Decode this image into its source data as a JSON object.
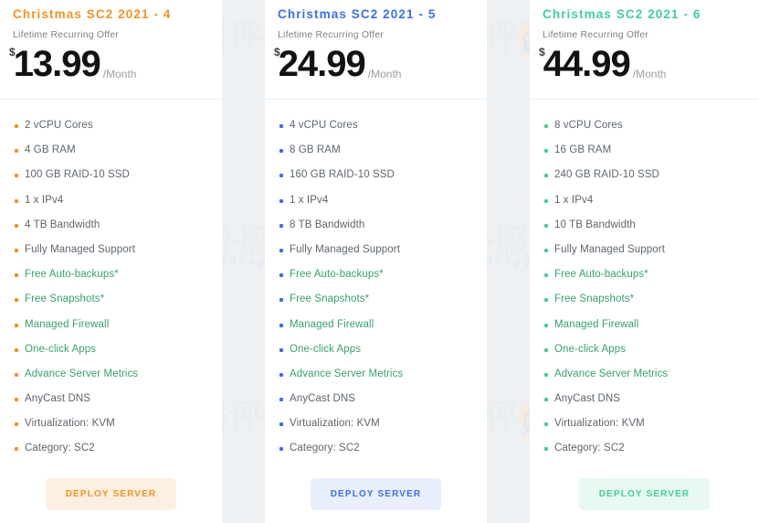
{
  "watermark": {
    "cn_text": "国外服务器评测",
    "url_text": "-www.idcspy.org-",
    "logo_icon": "globe-speech-bubble-logo"
  },
  "columns": [
    {
      "id": "sc2-2021-4",
      "title": "Christmas SC2 2021 - 4",
      "subtitle": "Lifetime Recurring Offer",
      "currency": "$",
      "amount": "13.99",
      "period": "/Month",
      "accent": "#f6921e",
      "title_color": "#f6921e",
      "bullet_color": "#f6921e",
      "button": {
        "label": "DEPLOY SERVER",
        "bg": "#fdf0e2",
        "fg": "#f6921e"
      },
      "features": [
        {
          "text": "2 vCPU Cores",
          "highlight": false
        },
        {
          "text": "4 GB RAM",
          "highlight": false
        },
        {
          "text": "100 GB RAID-10 SSD",
          "highlight": false
        },
        {
          "text": "1 x IPv4",
          "highlight": false
        },
        {
          "text": "4 TB Bandwidth",
          "highlight": false
        },
        {
          "text": "Fully Managed Support",
          "highlight": false
        },
        {
          "text": "Free Auto-backups*",
          "highlight": true
        },
        {
          "text": "Free Snapshots*",
          "highlight": true
        },
        {
          "text": "Managed Firewall",
          "highlight": true
        },
        {
          "text": "One-click Apps",
          "highlight": true
        },
        {
          "text": "Advance Server Metrics",
          "highlight": true
        },
        {
          "text": "AnyCast DNS",
          "highlight": false
        },
        {
          "text": "Virtualization: KVM",
          "highlight": false
        },
        {
          "text": "Category: SC2",
          "highlight": false
        }
      ]
    },
    {
      "id": "sc2-2021-5",
      "title": "Christmas SC2 2021 - 5",
      "subtitle": "Lifetime Recurring Offer",
      "currency": "$",
      "amount": "24.99",
      "period": "/Month",
      "accent": "#3b6ef5",
      "title_color": "#3b6ef5",
      "bullet_color": "#3b6ef5",
      "button": {
        "label": "DEPLOY SERVER",
        "bg": "#e9effd",
        "fg": "#3b6ef5"
      },
      "features": [
        {
          "text": "4 vCPU Cores",
          "highlight": false
        },
        {
          "text": "8 GB RAM",
          "highlight": false
        },
        {
          "text": "160 GB RAID-10 SSD",
          "highlight": false
        },
        {
          "text": "1 x IPv4",
          "highlight": false
        },
        {
          "text": "8 TB Bandwidth",
          "highlight": false
        },
        {
          "text": "Fully Managed Support",
          "highlight": false
        },
        {
          "text": "Free Auto-backups*",
          "highlight": true
        },
        {
          "text": "Free Snapshots*",
          "highlight": true
        },
        {
          "text": "Managed Firewall",
          "highlight": true
        },
        {
          "text": "One-click Apps",
          "highlight": true
        },
        {
          "text": "Advance Server Metrics",
          "highlight": true
        },
        {
          "text": "AnyCast DNS",
          "highlight": false
        },
        {
          "text": "Virtualization: KVM",
          "highlight": false
        },
        {
          "text": "Category: SC2",
          "highlight": false
        }
      ]
    },
    {
      "id": "sc2-2021-6",
      "title": "Christmas SC2 2021 - 6",
      "subtitle": "Lifetime Recurring Offer",
      "currency": "$",
      "amount": "44.99",
      "period": "/Month",
      "accent": "#3fd09a",
      "title_color": "#3fd09a",
      "bullet_color": "#3fd09a",
      "button": {
        "label": "DEPLOY SERVER",
        "bg": "#e7f9f1",
        "fg": "#3fd09a"
      },
      "features": [
        {
          "text": "8 vCPU Cores",
          "highlight": false
        },
        {
          "text": "16 GB RAM",
          "highlight": false
        },
        {
          "text": "240 GB RAID-10 SSD",
          "highlight": false
        },
        {
          "text": "1 x IPv4",
          "highlight": false
        },
        {
          "text": "10 TB Bandwidth",
          "highlight": false
        },
        {
          "text": "Fully Managed Support",
          "highlight": false
        },
        {
          "text": "Free Auto-backups*",
          "highlight": true
        },
        {
          "text": "Free Snapshots*",
          "highlight": true
        },
        {
          "text": "Managed Firewall",
          "highlight": true
        },
        {
          "text": "One-click Apps",
          "highlight": true
        },
        {
          "text": "Advance Server Metrics",
          "highlight": true
        },
        {
          "text": "AnyCast DNS",
          "highlight": false
        },
        {
          "text": "Virtualization: KVM",
          "highlight": false
        },
        {
          "text": "Category: SC2",
          "highlight": false
        }
      ]
    }
  ]
}
